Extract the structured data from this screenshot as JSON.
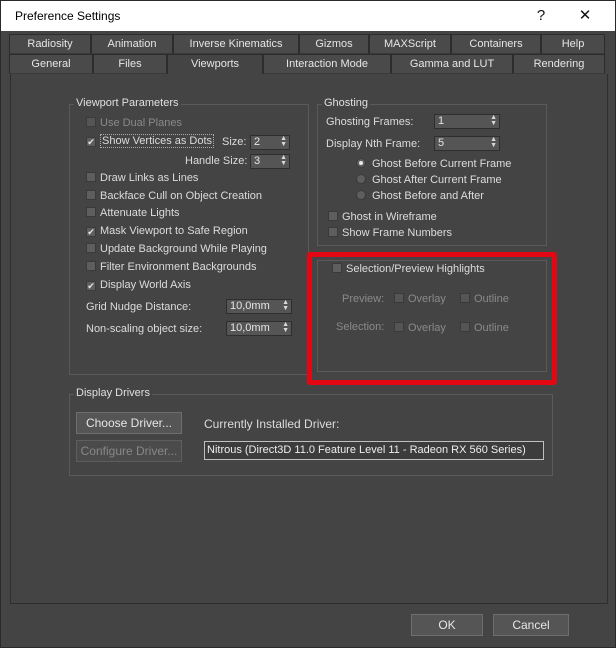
{
  "window": {
    "title": "Preference Settings",
    "help_glyph": "?",
    "close_glyph": "✕"
  },
  "tabs_row1": [
    "Radiosity",
    "Animation",
    "Inverse Kinematics",
    "Gizmos",
    "MAXScript",
    "Containers",
    "Help"
  ],
  "tabs_row2": [
    "General",
    "Files",
    "Viewports",
    "Interaction Mode",
    "Gamma and LUT",
    "Rendering"
  ],
  "viewport_params": {
    "title": "Viewport Parameters",
    "use_dual_planes": "Use Dual Planes",
    "show_vertices_as_dots": "Show Vertices as Dots",
    "size_label": "Size:",
    "size_value": "2",
    "handle_size_label": "Handle Size:",
    "handle_size_value": "3",
    "draw_links_as_lines": "Draw Links as Lines",
    "backface_cull": "Backface Cull on Object Creation",
    "attenuate_lights": "Attenuate Lights",
    "mask_viewport": "Mask Viewport to Safe Region",
    "update_background": "Update Background While Playing",
    "filter_env": "Filter Environment Backgrounds",
    "display_world_axis": "Display World Axis",
    "grid_nudge_label": "Grid Nudge Distance:",
    "grid_nudge_value": "10,0mm",
    "nonscaling_label": "Non-scaling object size:",
    "nonscaling_value": "10,0mm"
  },
  "ghosting": {
    "title": "Ghosting",
    "frames_label": "Ghosting Frames:",
    "frames_value": "1",
    "nth_label": "Display Nth Frame:",
    "nth_value": "5",
    "ghost_before": "Ghost Before Current Frame",
    "ghost_after": "Ghost After Current Frame",
    "ghost_both": "Ghost Before and After",
    "ghost_wireframe": "Ghost in Wireframe",
    "show_frame_numbers": "Show Frame Numbers"
  },
  "highlights": {
    "title": "Selection/Preview Highlights",
    "preview_label": "Preview:",
    "selection_label": "Selection:",
    "overlay": "Overlay",
    "outline": "Outline",
    "highlight_color": "#e30613"
  },
  "display_drivers": {
    "title": "Display Drivers",
    "choose_driver": "Choose Driver...",
    "configure_driver": "Configure Driver...",
    "installed_label": "Currently Installed Driver:",
    "installed_value": "Nitrous (Direct3D 11.0 Feature Level 11 - Radeon RX 560 Series)"
  },
  "footer": {
    "ok": "OK",
    "cancel": "Cancel"
  },
  "icons": {
    "check": "✔",
    "spin_up": "▲",
    "spin_down": "▼"
  }
}
